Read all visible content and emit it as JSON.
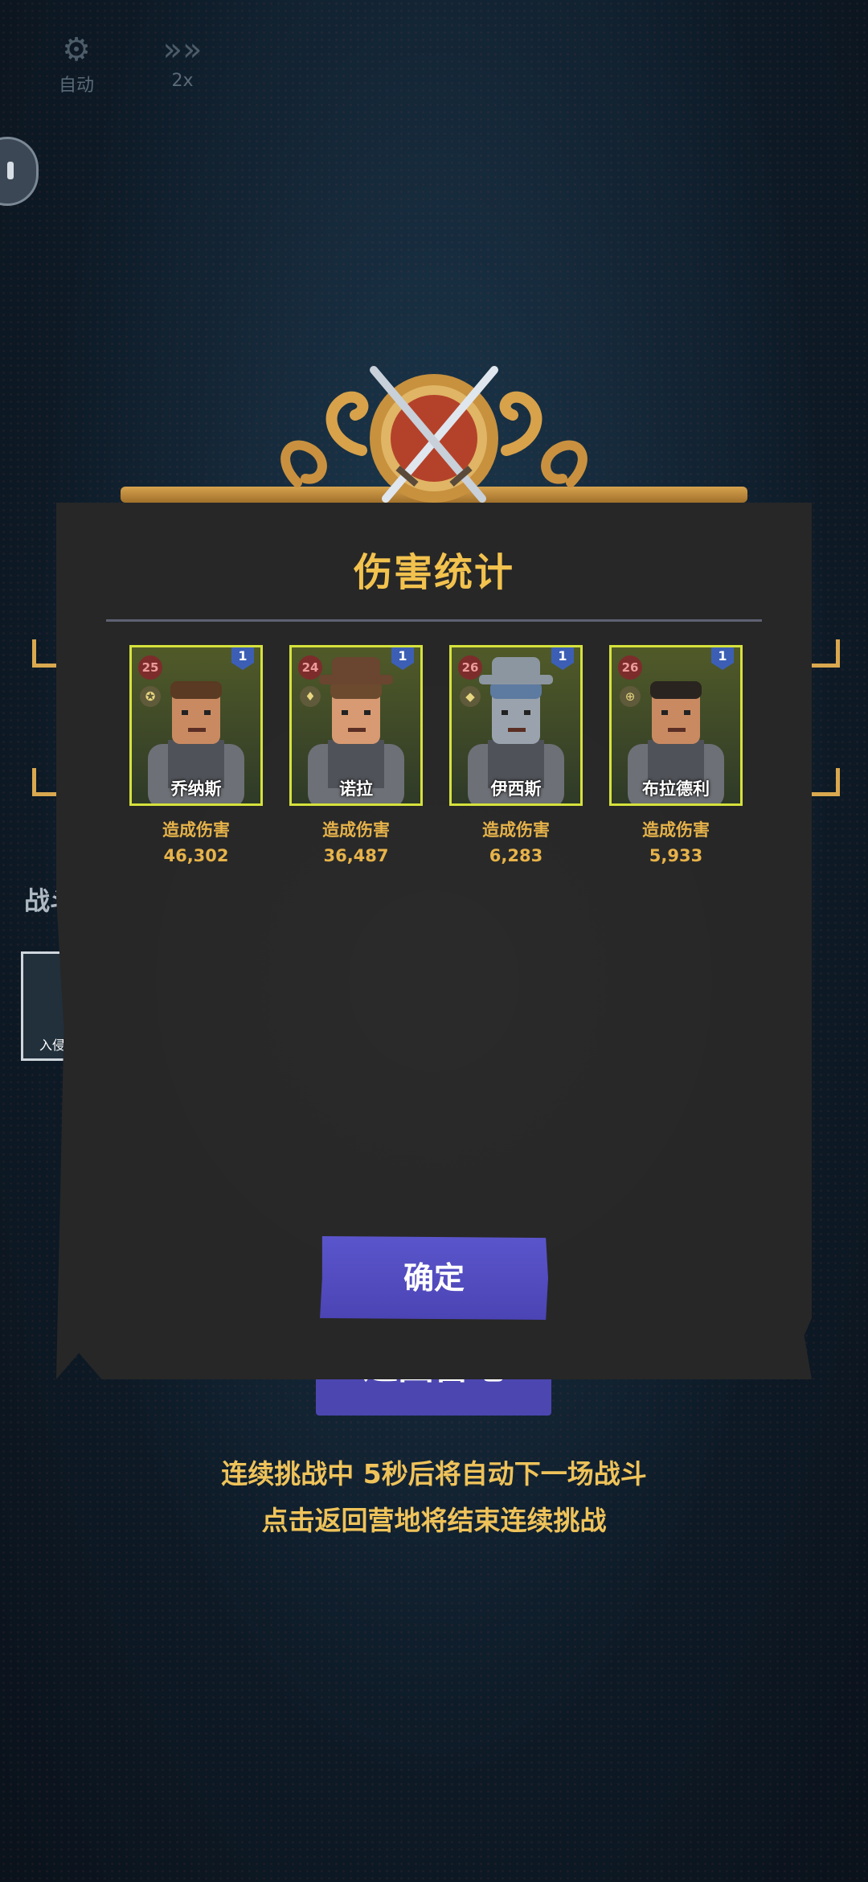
{
  "top_controls": {
    "auto_label": "自动",
    "speed_label": "2x"
  },
  "background": {
    "side_text": "战斗",
    "thumb_label": "入侵",
    "return_button": "返回营地",
    "hint_line_1": "连续挑战中 5秒后将自动下一场战斗",
    "hint_line_2": "点击返回营地将结束连续挑战"
  },
  "dialog": {
    "title": "伤害统计",
    "confirm_label": "确定",
    "heroes": [
      {
        "name": "乔纳斯",
        "level": "25",
        "stars": "1",
        "damage_label": "造成伤害",
        "damage": "46,302",
        "class_icon": "pentagram-icon"
      },
      {
        "name": "诺拉",
        "level": "24",
        "stars": "1",
        "damage_label": "造成伤害",
        "damage": "36,487",
        "class_icon": "bell-icon"
      },
      {
        "name": "伊西斯",
        "level": "26",
        "stars": "1",
        "damage_label": "造成伤害",
        "damage": "6,283",
        "class_icon": "helmet-icon"
      },
      {
        "name": "布拉德利",
        "level": "26",
        "stars": "1",
        "damage_label": "造成伤害",
        "damage": "5,933",
        "class_icon": "crosshair-icon"
      }
    ]
  },
  "colors": {
    "title_gold": "#f2c24e",
    "card_border": "#d6e23c",
    "button_purple": "#524cc0",
    "panel_bg": "#272727"
  }
}
